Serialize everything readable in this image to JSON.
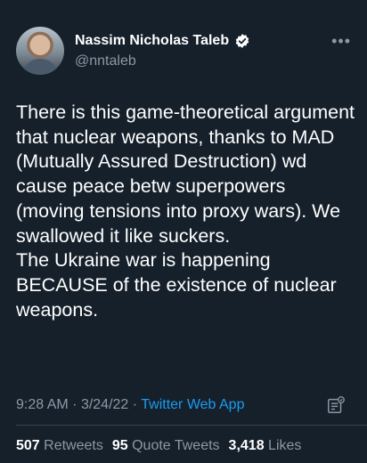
{
  "author": {
    "name": "Nassim Nicholas Taleb",
    "handle": "@nntaleb"
  },
  "tweet": {
    "text": "There is this game-theoretical argument that nuclear weapons, thanks to MAD (Mutually Assured Destruction) wd cause peace betw superpowers (moving tensions into proxy wars). We swallowed it like suckers.\nThe Ukraine war is happening BECAUSE of the existence of nuclear weapons.",
    "time": "9:28 AM",
    "date": "3/24/22",
    "source": "Twitter Web App"
  },
  "stats": {
    "retweets_count": "507",
    "retweets_label": "Retweets",
    "quotes_count": "95",
    "quotes_label": "Quote Tweets",
    "likes_count": "3,418",
    "likes_label": "Likes"
  },
  "colors": {
    "background": "#15202b",
    "accent": "#1d9bf0",
    "muted": "#8b98a5"
  },
  "icons": {
    "verified": "verified-badge-icon",
    "more": "more-horizontal-icon",
    "analytics": "analytics-icon"
  }
}
